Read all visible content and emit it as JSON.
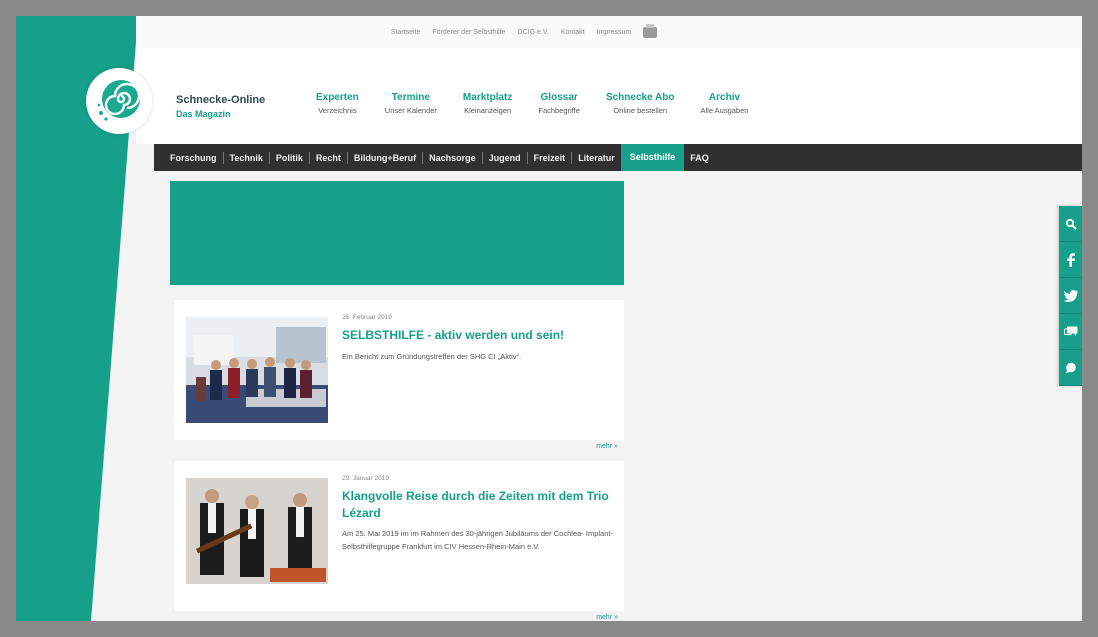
{
  "top_links": [
    "Startseite",
    "Förderer der Selbsthilfe",
    "DCIG e.V.",
    "Kontakt",
    "Impressum"
  ],
  "brand": {
    "name": "Schnecke-Online",
    "subtitle": "Das Magazin"
  },
  "main_nav": [
    {
      "title": "Experten",
      "sub": "Verzeichnis"
    },
    {
      "title": "Termine",
      "sub": "Unser Kalender"
    },
    {
      "title": "Marktplatz",
      "sub": "Kleinanzeigen"
    },
    {
      "title": "Glossar",
      "sub": "Fachbegriffe"
    },
    {
      "title": "Schnecke Abo",
      "sub": "Online bestellen"
    },
    {
      "title": "Archiv",
      "sub": "Alle Ausgaben"
    }
  ],
  "categories": [
    "Forschung",
    "Technik",
    "Politik",
    "Recht",
    "Bildung+Beruf",
    "Nachsorge",
    "Jugend",
    "Freizeit",
    "Literatur",
    "Selbsthilfe",
    "FAQ"
  ],
  "active_category": "Selbsthilfe",
  "articles": [
    {
      "date": "25. Februar 2019",
      "title": "SELBSTHILFE - aktiv werden und sein!",
      "text": "Ein Bericht zum Gründungstreffen der SHG CI „Aktiv“.",
      "more": "mehr »"
    },
    {
      "date": "29. Januar 2019",
      "title": "Klangvolle Reise durch die Zeiten mit dem Trio Lézard",
      "text": "Am 25. Mai 2019 im im Rahmen des 30-jährigen Jubiläums der Cochlea- Implant-Selbsthilfegruppe Frankfurt im CIV Hessen-Rhein-Main e.V.",
      "more": "mehr »"
    }
  ],
  "social_icons": [
    "search-icon",
    "facebook-icon",
    "twitter-icon",
    "chat-icon",
    "comment-icon"
  ],
  "colors": {
    "accent": "#16a08a",
    "dark_bar": "#303030",
    "frame": "#8a8a8a"
  }
}
